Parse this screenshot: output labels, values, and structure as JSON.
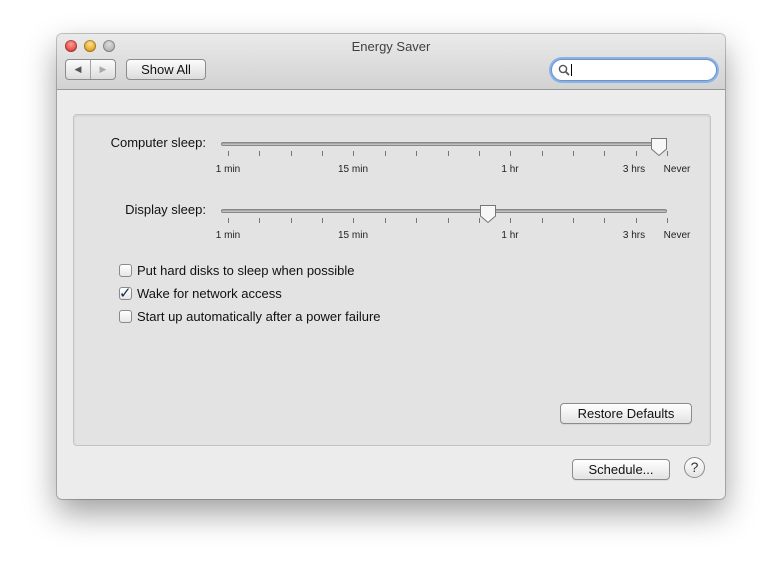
{
  "window": {
    "title": "Energy Saver"
  },
  "toolbar": {
    "back_icon": "◀",
    "forward_icon": "▶",
    "show_all_label": "Show All",
    "search_value": ""
  },
  "sliders": {
    "computer_sleep": {
      "label": "Computer sleep:",
      "value": "Never"
    },
    "display_sleep": {
      "label": "Display sleep:",
      "value": "1 hr"
    },
    "tick_labels": [
      "1 min",
      "15 min",
      "1 hr",
      "3 hrs",
      "Never"
    ]
  },
  "options": [
    {
      "label": "Put hard disks to sleep when possible",
      "checked": false
    },
    {
      "label": "Wake for network access",
      "checked": true
    },
    {
      "label": "Start up automatically after a power failure",
      "checked": false
    }
  ],
  "buttons": {
    "restore_defaults": "Restore Defaults",
    "schedule": "Schedule...",
    "help": "?"
  }
}
